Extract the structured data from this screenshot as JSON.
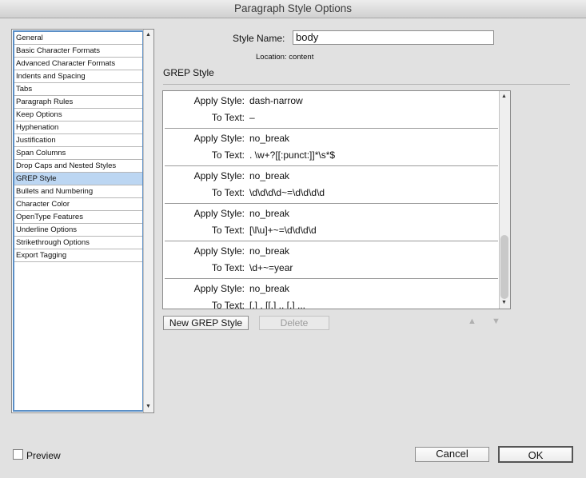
{
  "window": {
    "title": "Paragraph Style Options"
  },
  "categories": [
    "General",
    "Basic Character Formats",
    "Advanced Character Formats",
    "Indents and Spacing",
    "Tabs",
    "Paragraph Rules",
    "Keep Options",
    "Hyphenation",
    "Justification",
    "Span Columns",
    "Drop Caps and Nested Styles",
    "GREP Style",
    "Bullets and Numbering",
    "Character Color",
    "OpenType Features",
    "Underline Options",
    "Strikethrough Options",
    "Export Tagging"
  ],
  "selected_category": "GREP Style",
  "style_name": {
    "label": "Style Name:",
    "value": "body"
  },
  "location": {
    "text": "Location:  content"
  },
  "section_title": "GREP Style",
  "grep_labels": {
    "apply": "Apply Style:",
    "to": "To Text:"
  },
  "grep_styles": [
    {
      "apply": "dash-narrow",
      "to": "–"
    },
    {
      "apply": "no_break",
      "to": ". \\w+?[[:punct:]]*\\s*$"
    },
    {
      "apply": "no_break",
      "to": "\\d\\d\\d\\d~=\\d\\d\\d\\d"
    },
    {
      "apply": "no_break",
      "to": "[\\l\\u]+~=\\d\\d\\d\\d"
    },
    {
      "apply": "no_break",
      "to": "\\d+~=year"
    },
    {
      "apply": "no_break",
      "to": "[.] , [[.] .. [.] ..."
    }
  ],
  "buttons": {
    "new_grep": "New GREP Style",
    "delete": "Delete",
    "cancel": "Cancel",
    "ok": "OK"
  },
  "preview": {
    "label": "Preview",
    "checked": false
  }
}
